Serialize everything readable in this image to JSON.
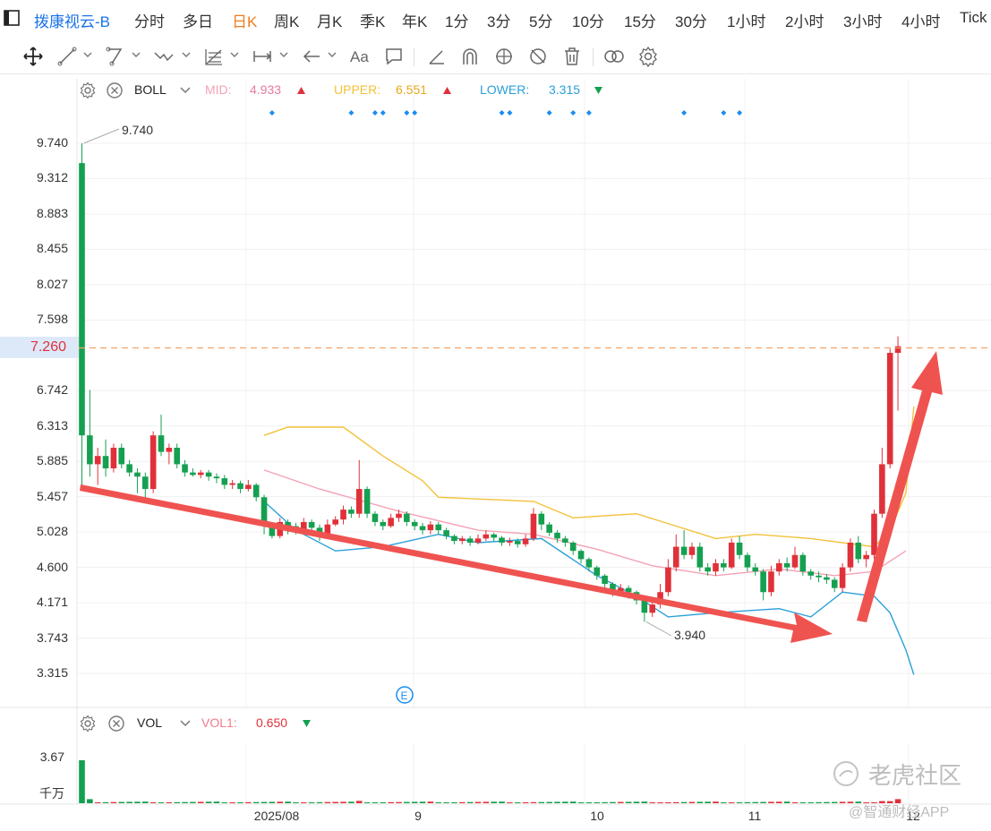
{
  "tabs": {
    "title": "拨康视云-B",
    "items": [
      "分时",
      "多日",
      "日K",
      "周K",
      "月K",
      "季K",
      "年K",
      "1分",
      "3分",
      "5分",
      "10分",
      "15分",
      "30分",
      "1小时",
      "2小时",
      "3小时",
      "4小时",
      "Tick"
    ],
    "active": "日K"
  },
  "toolbar": {
    "icons": [
      "move-icon",
      "line-icon",
      "segment-icon",
      "wave-icon",
      "fib-icon",
      "measure-icon",
      "arrow-icon",
      "text-icon",
      "comment-icon",
      "ruler-icon",
      "magnet-icon",
      "lock-icon",
      "hide-icon",
      "trash-icon",
      "compare-icon",
      "settings-icon"
    ]
  },
  "boll": {
    "name": "BOLL",
    "mid_label": "MID:",
    "mid_value": "4.933",
    "upper_label": "UPPER:",
    "upper_value": "6.551",
    "lower_label": "LOWER:",
    "lower_value": "3.315",
    "mid_color": "#f4a3b4",
    "upper_color": "#f2c23a",
    "lower_color": "#2aa0d8"
  },
  "vol": {
    "name": "VOL",
    "vol1_label": "VOL1:",
    "vol1_value": "0.650",
    "axis_top": "3.67",
    "axis_unit": "千万"
  },
  "current_price": "7.260",
  "event_marker": "E",
  "watermark": {
    "brand": "老虎社区",
    "source": "@智通财经APP"
  },
  "colors": {
    "up": "#e0313a",
    "down": "#14a050",
    "accent": "#1a73e8",
    "active_tab": "#f07c1c"
  },
  "chart_data": {
    "type": "candlestick",
    "y_ticks": [
      "9.740",
      "9.312",
      "8.883",
      "8.455",
      "8.027",
      "7.598",
      "6.742",
      "6.313",
      "5.885",
      "5.457",
      "5.028",
      "4.600",
      "4.171",
      "3.743",
      "3.315"
    ],
    "x_ticks": [
      "2025/08",
      "9",
      "10",
      "11",
      "12"
    ],
    "high_label": "9.740",
    "low_label": "3.940",
    "ylim": [
      3.0,
      10.0
    ],
    "candles": [
      [
        9.5,
        6.2,
        9.74,
        5.6
      ],
      [
        6.2,
        5.85,
        6.75,
        5.7
      ],
      [
        5.85,
        5.95,
        6.05,
        5.6
      ],
      [
        5.95,
        5.8,
        6.15,
        5.7
      ],
      [
        5.8,
        6.05,
        6.1,
        5.75
      ],
      [
        6.05,
        5.85,
        6.1,
        5.8
      ],
      [
        5.85,
        5.75,
        5.9,
        5.7
      ],
      [
        5.75,
        5.7,
        5.8,
        5.5
      ],
      [
        5.7,
        5.55,
        5.75,
        5.45
      ],
      [
        5.55,
        6.2,
        6.25,
        5.5
      ],
      [
        6.2,
        6.0,
        6.45,
        5.95
      ],
      [
        6.0,
        6.05,
        6.1,
        5.85
      ],
      [
        6.05,
        5.85,
        6.1,
        5.8
      ],
      [
        5.85,
        5.75,
        5.9,
        5.7
      ],
      [
        5.75,
        5.72,
        5.8,
        5.7
      ],
      [
        5.72,
        5.75,
        5.78,
        5.68
      ],
      [
        5.75,
        5.7,
        5.78,
        5.65
      ],
      [
        5.7,
        5.68,
        5.74,
        5.62
      ],
      [
        5.68,
        5.6,
        5.72,
        5.55
      ],
      [
        5.6,
        5.62,
        5.66,
        5.55
      ],
      [
        5.62,
        5.55,
        5.65,
        5.5
      ],
      [
        5.55,
        5.6,
        5.66,
        5.52
      ],
      [
        5.6,
        5.45,
        5.62,
        5.4
      ],
      [
        5.45,
        5.1,
        5.48,
        5.0
      ],
      [
        5.1,
        4.98,
        5.12,
        4.95
      ],
      [
        4.98,
        5.15,
        5.2,
        4.95
      ],
      [
        5.15,
        5.1,
        5.18,
        5.0
      ],
      [
        5.1,
        5.05,
        5.14,
        5.0
      ],
      [
        5.05,
        5.15,
        5.2,
        5.0
      ],
      [
        5.15,
        5.08,
        5.18,
        5.02
      ],
      [
        5.08,
        5.0,
        5.12,
        4.92
      ],
      [
        5.0,
        5.12,
        5.18,
        4.95
      ],
      [
        5.12,
        5.18,
        5.22,
        5.1
      ],
      [
        5.18,
        5.3,
        5.35,
        5.12
      ],
      [
        5.3,
        5.25,
        5.34,
        5.2
      ],
      [
        5.25,
        5.55,
        5.9,
        5.2
      ],
      [
        5.55,
        5.25,
        5.58,
        5.2
      ],
      [
        5.25,
        5.15,
        5.28,
        5.1
      ],
      [
        5.15,
        5.1,
        5.18,
        5.05
      ],
      [
        5.1,
        5.2,
        5.25,
        5.08
      ],
      [
        5.2,
        5.25,
        5.3,
        5.15
      ],
      [
        5.25,
        5.15,
        5.28,
        5.1
      ],
      [
        5.15,
        5.1,
        5.18,
        5.05
      ],
      [
        5.1,
        5.05,
        5.14,
        5.0
      ],
      [
        5.05,
        5.12,
        5.16,
        5.0
      ],
      [
        5.12,
        5.05,
        5.15,
        5.0
      ],
      [
        5.05,
        4.98,
        5.08,
        4.94
      ],
      [
        4.98,
        4.92,
        5.0,
        4.88
      ],
      [
        4.92,
        4.95,
        4.98,
        4.88
      ],
      [
        4.95,
        4.9,
        4.98,
        4.86
      ],
      [
        4.9,
        4.95,
        5.0,
        4.88
      ],
      [
        4.95,
        5.0,
        5.05,
        4.92
      ],
      [
        5.0,
        4.96,
        5.02,
        4.92
      ],
      [
        4.96,
        4.9,
        4.98,
        4.86
      ],
      [
        4.9,
        4.92,
        4.96,
        4.86
      ],
      [
        4.92,
        4.88,
        4.95,
        4.84
      ],
      [
        4.88,
        4.95,
        5.0,
        4.85
      ],
      [
        4.95,
        5.25,
        5.32,
        4.92
      ],
      [
        5.25,
        5.12,
        5.28,
        5.05
      ],
      [
        5.12,
        5.02,
        5.15,
        4.98
      ],
      [
        5.02,
        4.95,
        5.05,
        4.9
      ],
      [
        4.95,
        4.9,
        4.98,
        4.85
      ],
      [
        4.9,
        4.8,
        4.92,
        4.75
      ],
      [
        4.8,
        4.7,
        4.82,
        4.65
      ],
      [
        4.7,
        4.6,
        4.72,
        4.55
      ],
      [
        4.6,
        4.5,
        4.62,
        4.45
      ],
      [
        4.5,
        4.4,
        4.52,
        4.35
      ],
      [
        4.4,
        4.3,
        4.42,
        4.25
      ],
      [
        4.3,
        4.35,
        4.4,
        4.25
      ],
      [
        4.35,
        4.3,
        4.38,
        4.22
      ],
      [
        4.3,
        4.2,
        4.32,
        4.15
      ],
      [
        4.2,
        4.05,
        4.22,
        3.94
      ],
      [
        4.05,
        4.15,
        4.2,
        4.0
      ],
      [
        4.15,
        4.3,
        4.4,
        4.1
      ],
      [
        4.3,
        4.6,
        4.7,
        4.25
      ],
      [
        4.6,
        4.85,
        5.0,
        4.55
      ],
      [
        4.85,
        4.75,
        5.05,
        4.7
      ],
      [
        4.75,
        4.85,
        4.9,
        4.7
      ],
      [
        4.85,
        4.6,
        4.9,
        4.55
      ],
      [
        4.6,
        4.55,
        4.65,
        4.5
      ],
      [
        4.55,
        4.65,
        4.7,
        4.5
      ],
      [
        4.65,
        4.6,
        4.7,
        4.55
      ],
      [
        4.6,
        4.9,
        4.95,
        4.58
      ],
      [
        4.9,
        4.75,
        4.98,
        4.7
      ],
      [
        4.75,
        4.6,
        4.78,
        4.55
      ],
      [
        4.6,
        4.55,
        4.65,
        4.5
      ],
      [
        4.55,
        4.3,
        4.58,
        4.2
      ],
      [
        4.3,
        4.55,
        4.62,
        4.25
      ],
      [
        4.55,
        4.65,
        4.7,
        4.5
      ],
      [
        4.65,
        4.6,
        4.72,
        4.55
      ],
      [
        4.6,
        4.75,
        4.85,
        4.58
      ],
      [
        4.75,
        4.55,
        4.78,
        4.5
      ],
      [
        4.55,
        4.5,
        4.58,
        4.45
      ],
      [
        4.5,
        4.48,
        4.55,
        4.42
      ],
      [
        4.48,
        4.45,
        4.52,
        4.4
      ],
      [
        4.45,
        4.35,
        4.48,
        4.3
      ],
      [
        4.35,
        4.6,
        4.65,
        4.3
      ],
      [
        4.6,
        4.9,
        4.95,
        4.55
      ],
      [
        4.9,
        4.7,
        4.98,
        4.65
      ],
      [
        4.7,
        4.75,
        4.8,
        4.6
      ],
      [
        4.75,
        5.25,
        5.3,
        4.7
      ],
      [
        5.25,
        5.85,
        6.05,
        5.2
      ],
      [
        5.85,
        7.2,
        7.25,
        5.8
      ],
      [
        7.2,
        7.28,
        7.4,
        6.5
      ]
    ],
    "boll_mid": [
      [
        23,
        5.78
      ],
      [
        30,
        5.55
      ],
      [
        40,
        5.28
      ],
      [
        50,
        5.05
      ],
      [
        57,
        5.0
      ],
      [
        65,
        4.82
      ],
      [
        72,
        4.62
      ],
      [
        80,
        4.5
      ],
      [
        88,
        4.58
      ],
      [
        95,
        4.5
      ],
      [
        100,
        4.55
      ],
      [
        104,
        4.8
      ]
    ],
    "boll_upper": [
      [
        23,
        6.2
      ],
      [
        26,
        6.3
      ],
      [
        33,
        6.3
      ],
      [
        38,
        5.95
      ],
      [
        43,
        5.65
      ],
      [
        45,
        5.45
      ],
      [
        57,
        5.4
      ],
      [
        62,
        5.2
      ],
      [
        70,
        5.25
      ],
      [
        75,
        5.1
      ],
      [
        80,
        4.95
      ],
      [
        85,
        5.0
      ],
      [
        92,
        4.95
      ],
      [
        100,
        4.85
      ],
      [
        102,
        5.05
      ],
      [
        104,
        5.5
      ],
      [
        105,
        6.55
      ]
    ],
    "boll_lower": [
      [
        23,
        5.4
      ],
      [
        27,
        5.05
      ],
      [
        32,
        4.8
      ],
      [
        38,
        4.85
      ],
      [
        45,
        5.0
      ],
      [
        50,
        4.9
      ],
      [
        58,
        4.95
      ],
      [
        65,
        4.5
      ],
      [
        70,
        4.25
      ],
      [
        74,
        4.0
      ],
      [
        80,
        4.05
      ],
      [
        88,
        4.1
      ],
      [
        92,
        4.0
      ],
      [
        96,
        4.3
      ],
      [
        100,
        4.25
      ],
      [
        102,
        4.05
      ],
      [
        104,
        3.6
      ],
      [
        105,
        3.3
      ]
    ],
    "event_dots_x": [
      24,
      34,
      37,
      38,
      41,
      42,
      53,
      54,
      59,
      62,
      64,
      76,
      81,
      83
    ]
  }
}
